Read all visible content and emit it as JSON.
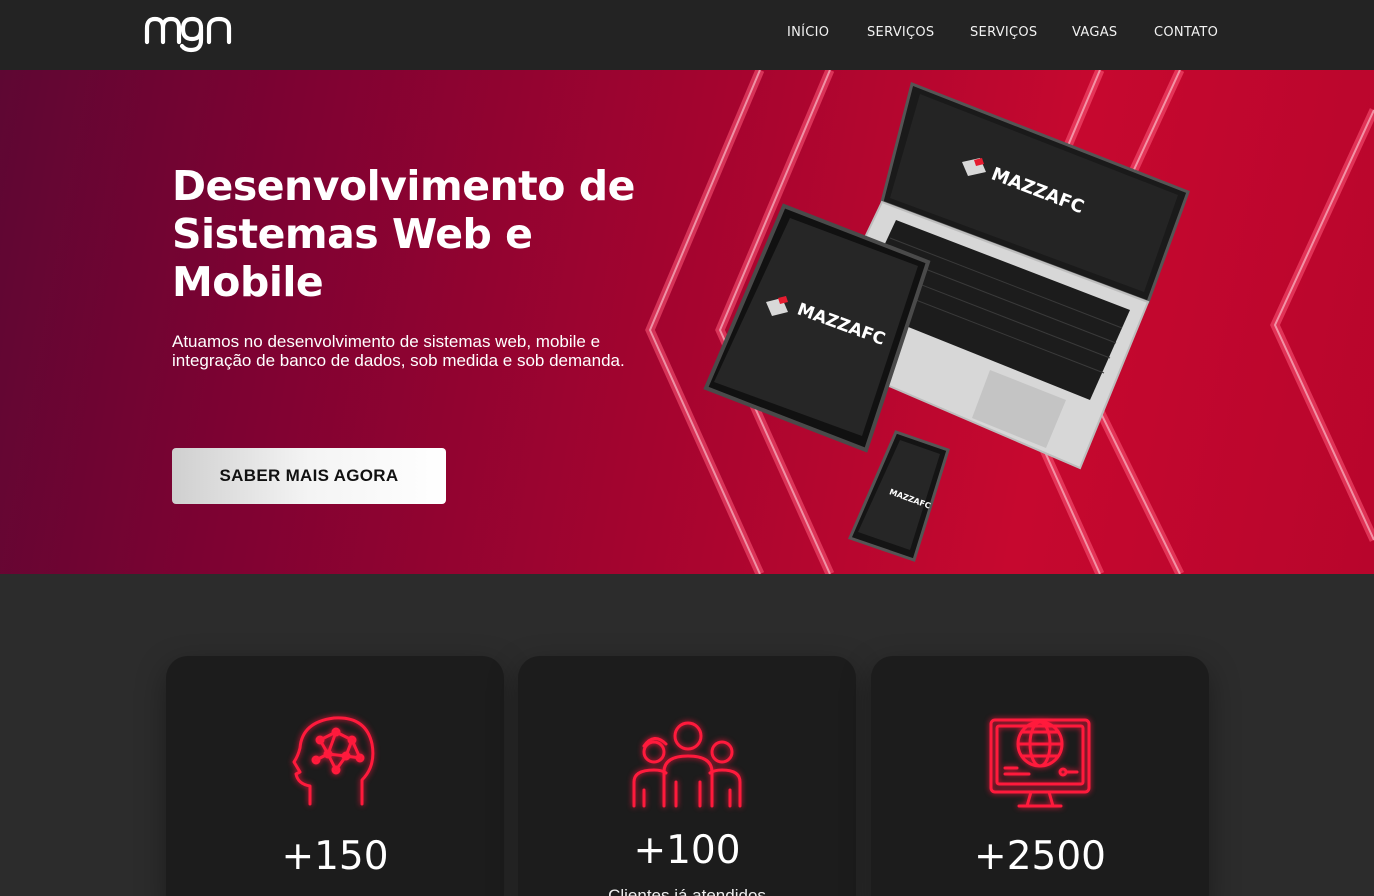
{
  "brand": {
    "logo_text": "mgn"
  },
  "nav": {
    "items": [
      "INÍCIO",
      "SERVIÇOS",
      "SERVIÇOS",
      "VAGAS",
      "CONTATO"
    ]
  },
  "hero": {
    "title": "Desenvolvimento de Sistemas Web e Mobile",
    "subtitle": "Atuamos no desenvolvimento de sistemas web, mobile e integração de banco de dados, sob medida e sob demanda.",
    "cta_label": "SABER MAIS AGORA",
    "device_brand": "MAZZAFC"
  },
  "stats": [
    {
      "icon": "brain-network-icon",
      "value": "+150",
      "label": ""
    },
    {
      "icon": "people-group-icon",
      "value": "+100",
      "label": "Clientes já atendidos"
    },
    {
      "icon": "monitor-globe-icon",
      "value": "+2500",
      "label": ""
    }
  ],
  "colors": {
    "accent": "#ff1a3c",
    "navbar": "#232323",
    "page": "#2c2c2c",
    "card": "#1c1c1c"
  }
}
